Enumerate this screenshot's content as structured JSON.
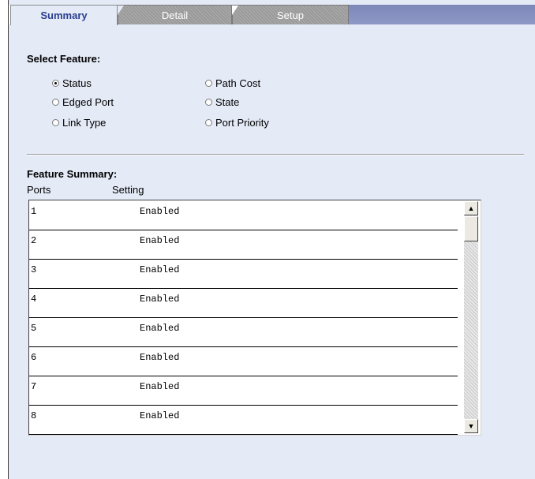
{
  "tabs": [
    {
      "label": "Summary",
      "active": true
    },
    {
      "label": "Detail",
      "active": false
    },
    {
      "label": "Setup",
      "active": false
    }
  ],
  "select_feature": {
    "label": "Select Feature:",
    "options": [
      {
        "label": "Status",
        "checked": true
      },
      {
        "label": "Edged Port",
        "checked": false
      },
      {
        "label": "Link Type",
        "checked": false
      },
      {
        "label": "Path Cost",
        "checked": false
      },
      {
        "label": "State",
        "checked": false
      },
      {
        "label": "Port Priority",
        "checked": false
      }
    ]
  },
  "feature_summary": {
    "label": "Feature Summary:",
    "columns": [
      "Ports",
      "Setting"
    ],
    "rows": [
      {
        "port": "1",
        "setting": "Enabled"
      },
      {
        "port": "2",
        "setting": "Enabled"
      },
      {
        "port": "3",
        "setting": "Enabled"
      },
      {
        "port": "4",
        "setting": "Enabled"
      },
      {
        "port": "5",
        "setting": "Enabled"
      },
      {
        "port": "6",
        "setting": "Enabled"
      },
      {
        "port": "7",
        "setting": "Enabled"
      },
      {
        "port": "8",
        "setting": "Enabled"
      }
    ]
  },
  "icons": {
    "scroll_up": "up-arrow-icon",
    "scroll_down": "down-arrow-icon"
  },
  "colors": {
    "panel_bg": "#e4eaf6",
    "active_tab_text": "#2a3f8f",
    "tab_strip": "#8e98c6"
  }
}
